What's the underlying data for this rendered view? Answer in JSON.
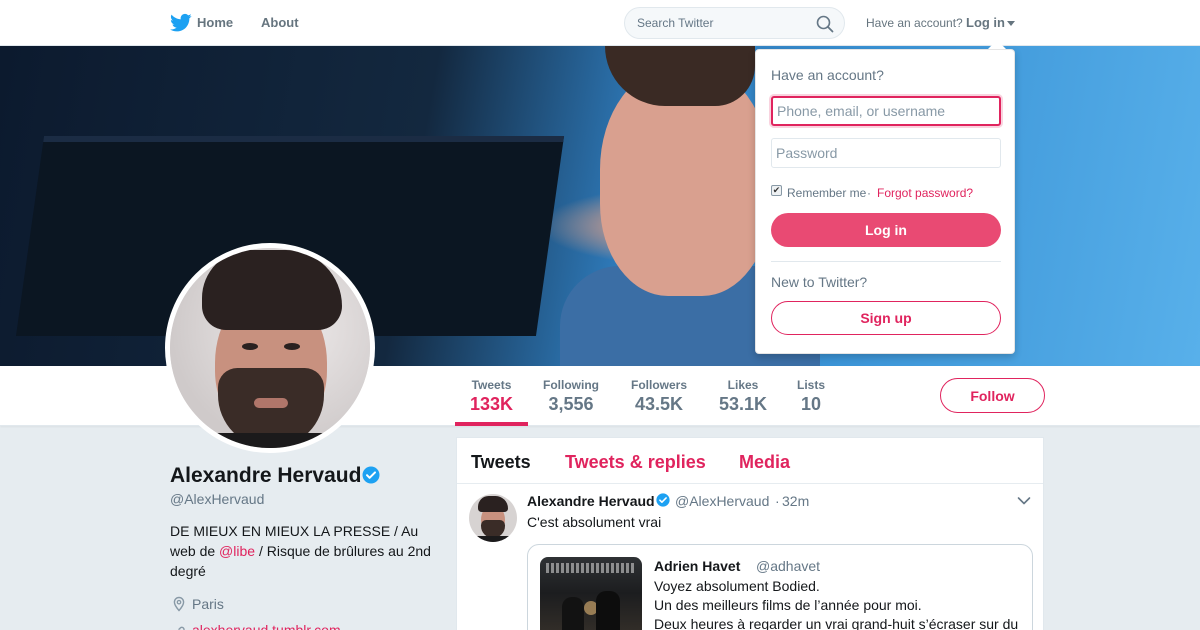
{
  "nav": {
    "home_label": "Home",
    "about_label": "About",
    "search_placeholder": "Search Twitter",
    "have_account": "Have an account?",
    "login_label": "Log in"
  },
  "profile": {
    "name": "Alexandre Hervaud",
    "handle": "@AlexHervaud",
    "bio_part1": "DE MIEUX EN MIEUX LA PRESSE / Au web de ",
    "bio_mention": "@libe",
    "bio_part2": " / Risque de brûlures au 2nd degré",
    "location": "Paris",
    "website": "alexhervaud.tumblr.com",
    "verified": true
  },
  "stats": [
    {
      "label": "Tweets",
      "value": "133K",
      "active": true
    },
    {
      "label": "Following",
      "value": "3,556"
    },
    {
      "label": "Followers",
      "value": "43.5K"
    },
    {
      "label": "Likes",
      "value": "53.1K"
    },
    {
      "label": "Lists",
      "value": "10"
    }
  ],
  "follow_label": "Follow",
  "timeline": {
    "tabs": [
      {
        "label": "Tweets",
        "active": true
      },
      {
        "label": "Tweets & replies"
      },
      {
        "label": "Media"
      }
    ],
    "tweet": {
      "author": "Alexandre Hervaud",
      "handle": "@AlexHervaud",
      "separator": "·",
      "time": "32m",
      "text": "C'est absolument vrai",
      "quote": {
        "author": "Adrien Havet",
        "handle": "@adhavet",
        "lines": [
          "Voyez absolument Bodied.",
          "Un des meilleurs films de l’année pour moi.",
          "Deux heures à regarder un vrai grand-huit s’écraser sur du"
        ]
      }
    }
  },
  "login_dropdown": {
    "title": "Have an account?",
    "username_placeholder": "Phone, email, or username",
    "password_placeholder": "Password",
    "remember_label": "Remember me",
    "separator": "·",
    "forgot_label": "Forgot password?",
    "remember_checked": true,
    "login_button": "Log in",
    "new_label": "New to Twitter?",
    "signup_button": "Sign up"
  },
  "colors": {
    "accent": "#e0245e",
    "twitter_blue": "#1da1f2",
    "background": "#e6ecf0"
  }
}
